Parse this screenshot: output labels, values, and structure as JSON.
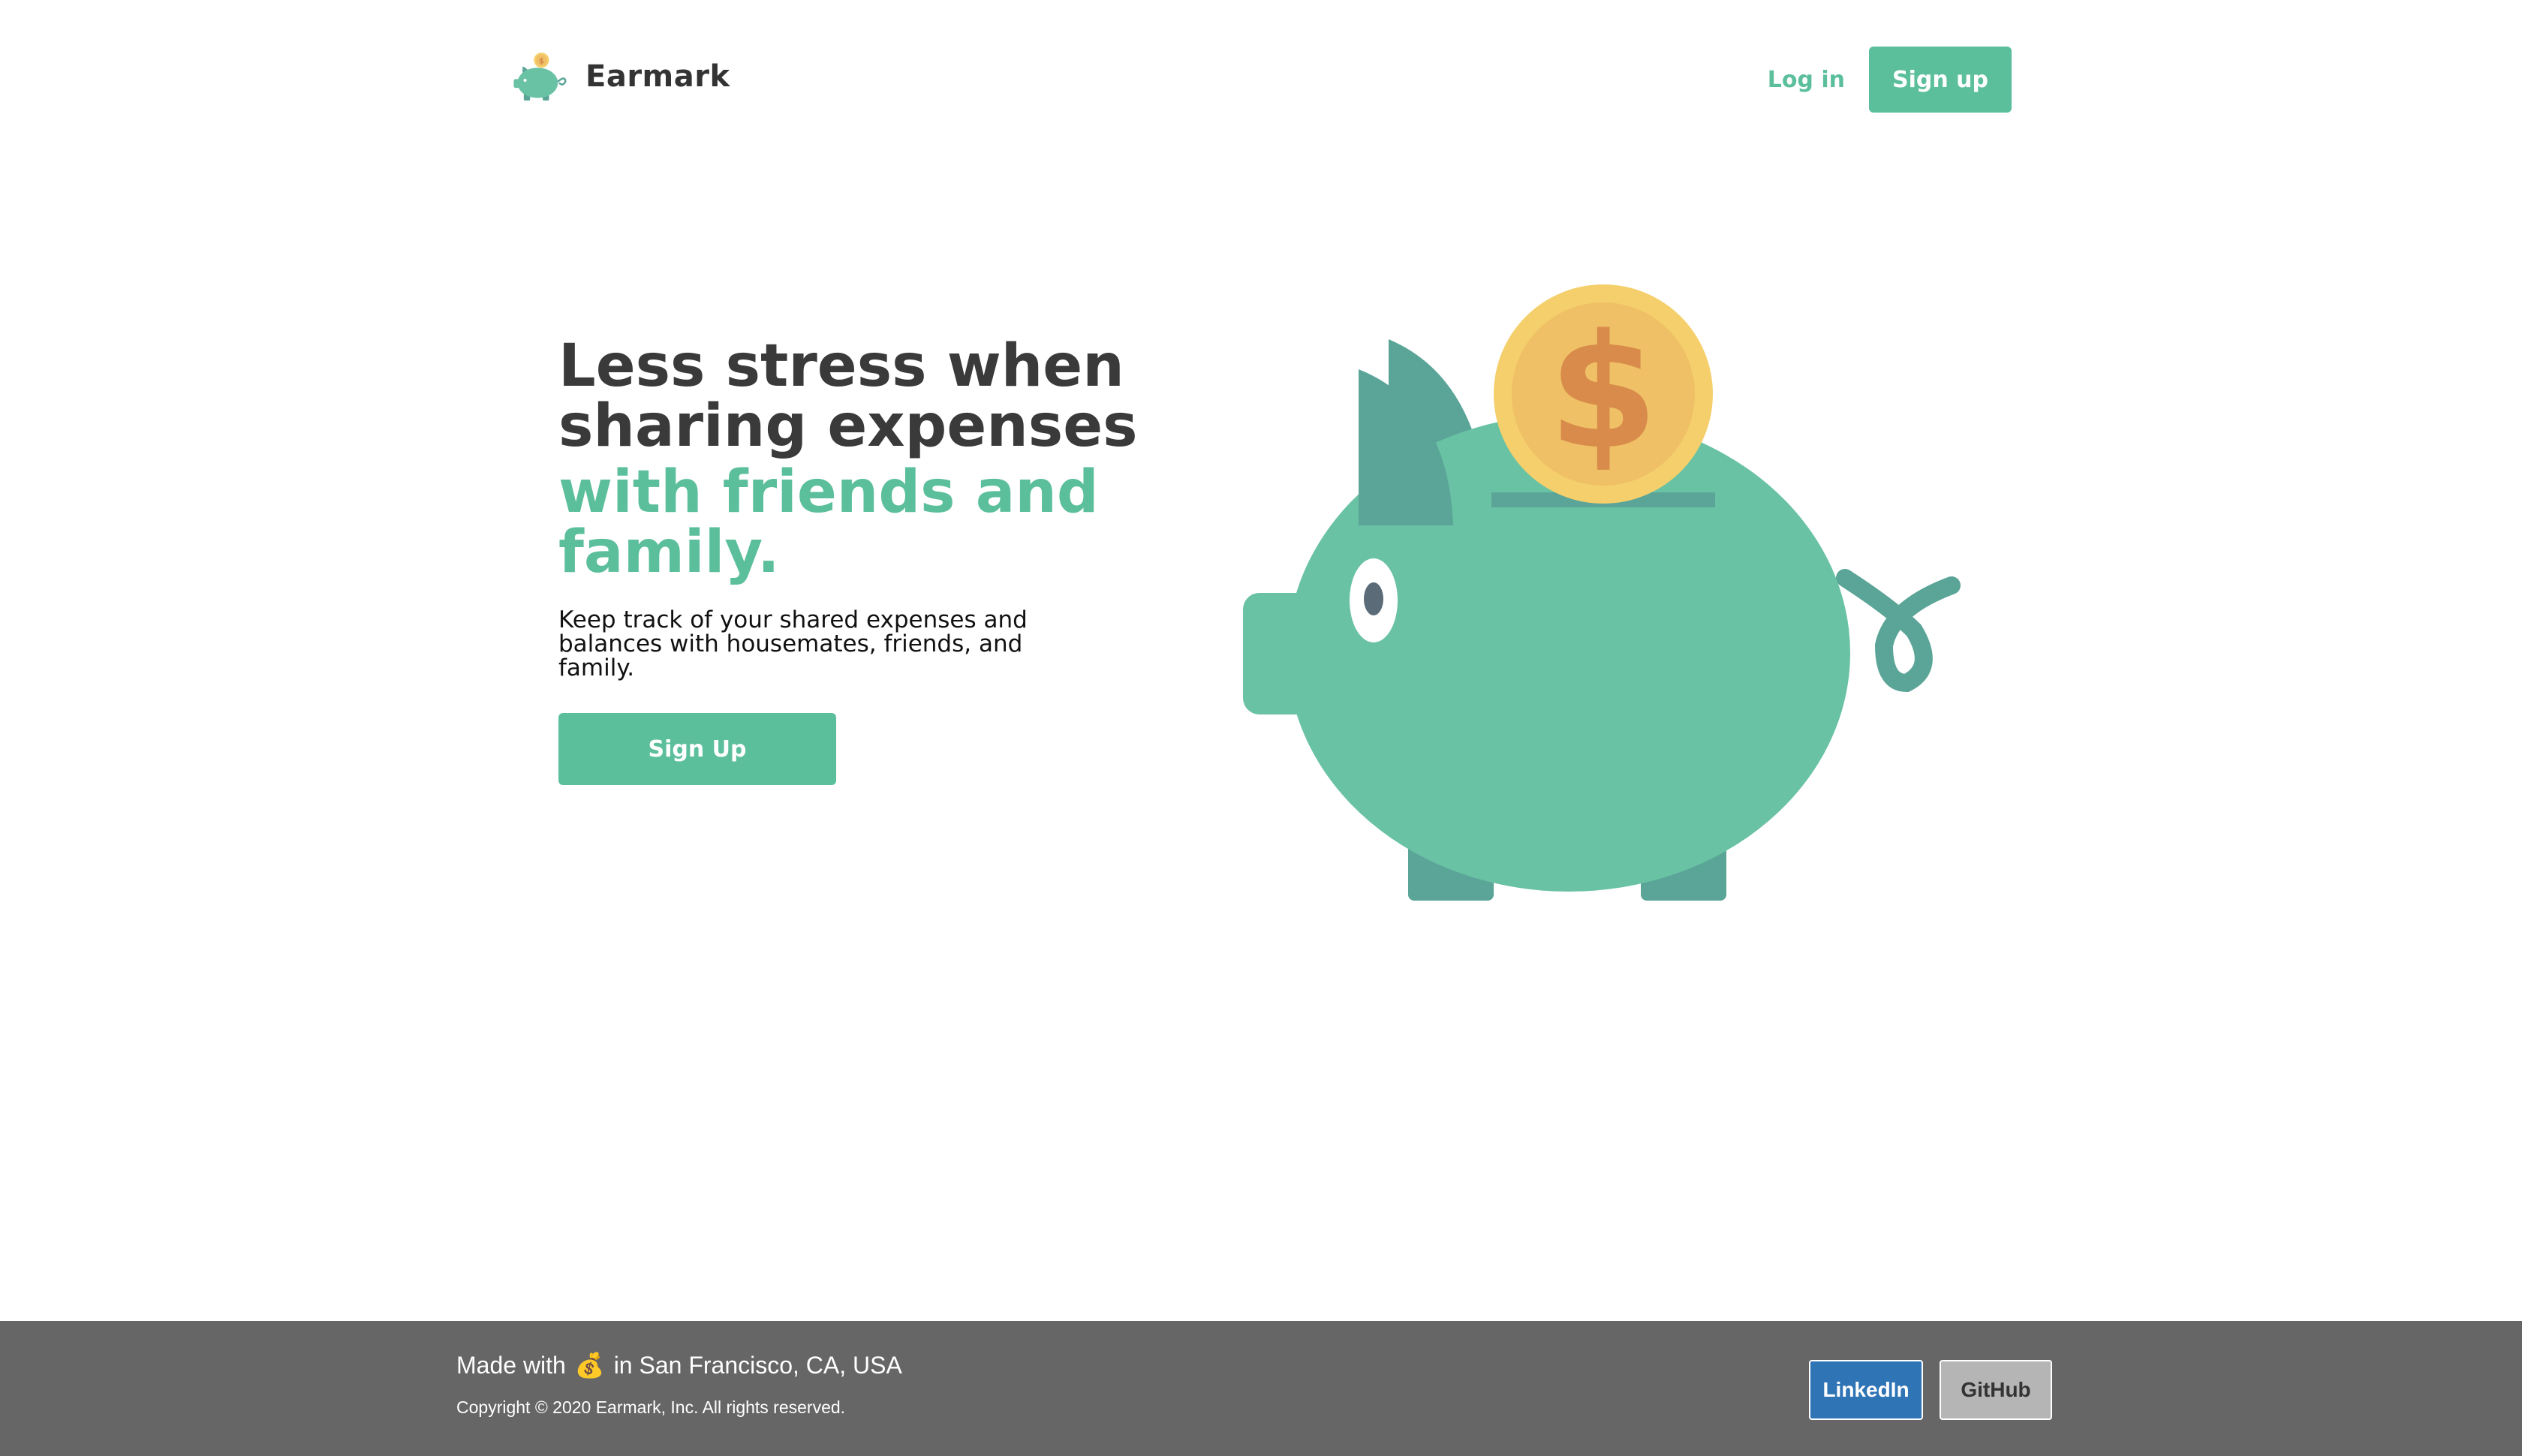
{
  "header": {
    "brand_name": "Earmark",
    "login_label": "Log in",
    "signup_label": "Sign up"
  },
  "hero": {
    "headline": "Less stress when sharing expenses",
    "headline_accent": "with friends and family.",
    "subtext": "Keep track of your shared expenses and balances with housemates, friends, and family.",
    "cta_label": "Sign Up",
    "illustration_icon": "piggy-bank-icon",
    "coin_symbol": "$"
  },
  "footer": {
    "made_with_prefix": "Made with",
    "made_with_emoji": "💰",
    "made_with_suffix": "in San Francisco, CA, USA",
    "copyright": "Copyright © 2020 Earmark, Inc. All rights reserved.",
    "linkedin_label": "LinkedIn",
    "github_label": "GitHub"
  },
  "colors": {
    "accent": "#5bbf9c",
    "pig_body": "#6ac2a4",
    "pig_dark": "#5aa597",
    "coin_outer": "#f5cf6b",
    "coin_inner": "#efc066",
    "coin_symbol": "#d88b4a",
    "footer_bg": "#666666",
    "linkedin_bg": "#2f74b5",
    "github_bg": "#b5b5b5"
  }
}
